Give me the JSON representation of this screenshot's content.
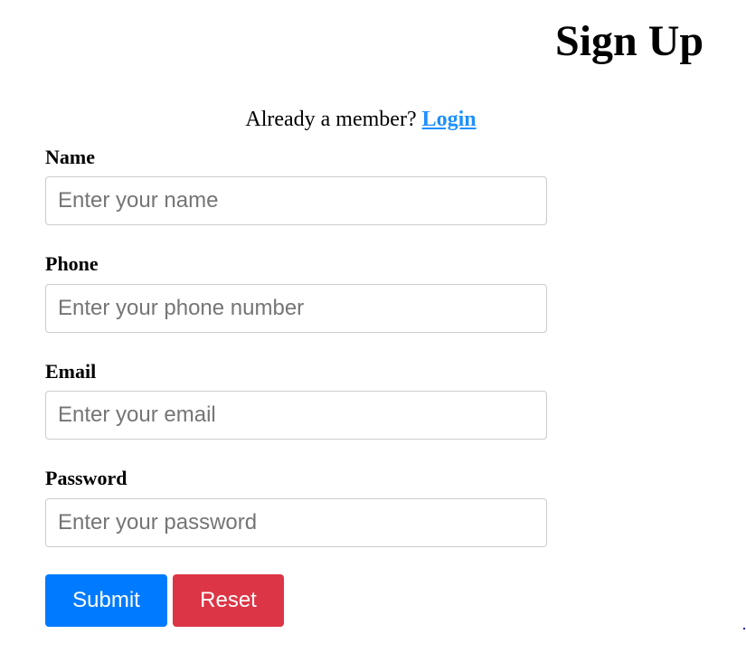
{
  "title": "Sign Up",
  "member_prompt": {
    "text": "Already a member? ",
    "link_label": "Login"
  },
  "fields": [
    {
      "label": "Name",
      "placeholder": "Enter your name",
      "value": ""
    },
    {
      "label": "Phone",
      "placeholder": "Enter your phone number",
      "value": ""
    },
    {
      "label": "Email",
      "placeholder": "Enter your email",
      "value": ""
    },
    {
      "label": "Password",
      "placeholder": "Enter your password",
      "value": ""
    }
  ],
  "buttons": {
    "submit": {
      "label": "Submit",
      "color": "#007bff"
    },
    "reset": {
      "label": "Reset",
      "color": "#dc3545"
    }
  },
  "colors": {
    "link": "#1e90ff",
    "input_border": "#cccccc"
  }
}
